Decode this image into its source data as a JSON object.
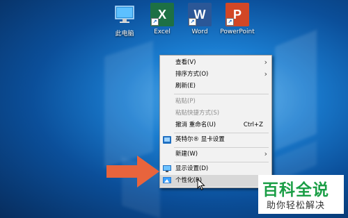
{
  "desktop_icons": [
    {
      "name": "此电脑",
      "icon": "computer-icon"
    },
    {
      "name": "Excel",
      "icon": "excel-icon",
      "letter": "X",
      "color": "#1d7044"
    },
    {
      "name": "Word",
      "icon": "word-icon",
      "letter": "W",
      "color": "#2b5797"
    },
    {
      "name": "PowerPoint",
      "icon": "powerpoint-icon",
      "letter": "P",
      "color": "#d24726"
    }
  ],
  "context_menu": {
    "items": [
      {
        "label": "查看(V)",
        "submenu": true
      },
      {
        "label": "排序方式(O)",
        "submenu": true
      },
      {
        "label": "刷新(E)"
      },
      {
        "label": "粘贴(P)",
        "disabled": true
      },
      {
        "label": "粘贴快捷方式(S)",
        "disabled": true
      },
      {
        "label": "撤消 重命名(U)",
        "shortcut": "Ctrl+Z"
      },
      {
        "label": "英特尔® 显卡设置",
        "icon": "intel-graphics-icon"
      },
      {
        "label": "新建(W)",
        "submenu": true
      },
      {
        "label": "显示设置(D)",
        "icon": "display-icon"
      },
      {
        "label": "个性化(R)",
        "icon": "personalize-icon",
        "highlighted": true
      }
    ],
    "submenu_arrow": "›"
  },
  "watermark": {
    "title": "百科全说",
    "subtitle": "助你轻松解决"
  },
  "colors": {
    "arrow": "#e8643c",
    "watermark_green": "#1b9e46",
    "menu_bg": "#f2f2f2"
  }
}
